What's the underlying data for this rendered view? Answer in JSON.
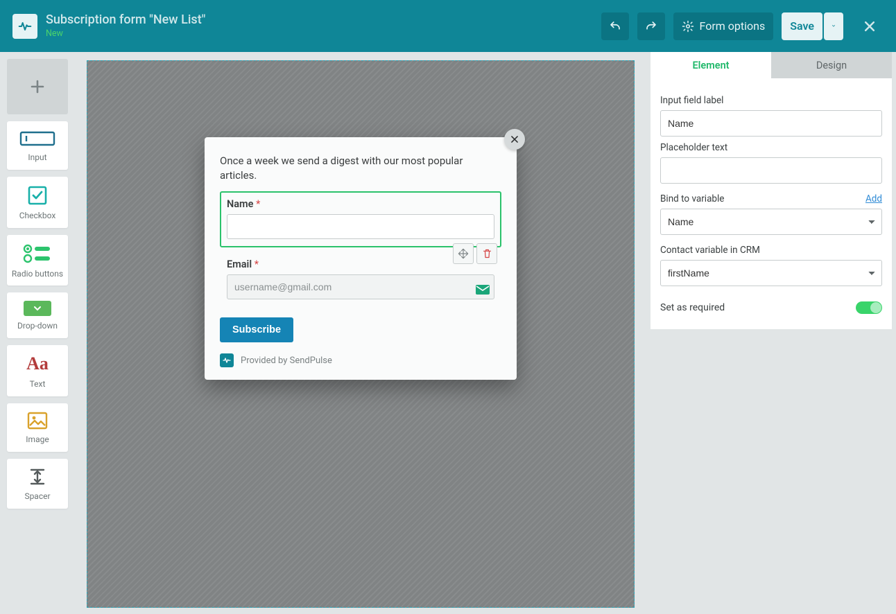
{
  "topbar": {
    "title": "Subscription form \"New List\"",
    "subtitle": "New",
    "form_options": "Form options",
    "save": "Save"
  },
  "tools": {
    "input": "Input",
    "checkbox": "Checkbox",
    "radio": "Radio buttons",
    "dropdown": "Drop-down",
    "text": "Text",
    "image": "Image",
    "spacer": "Spacer"
  },
  "form": {
    "description": "Once a week we send a digest with our most popular articles.",
    "name_label": "Name",
    "email_label": "Email",
    "email_placeholder": "username@gmail.com",
    "subscribe": "Subscribe",
    "provided": "Provided by SendPulse"
  },
  "panel": {
    "tab_element": "Element",
    "tab_design": "Design",
    "label_field_label": "Input field label",
    "field_label_value": "Name",
    "label_placeholder": "Placeholder text",
    "placeholder_value": "",
    "label_bind": "Bind to variable",
    "add_link": "Add",
    "bind_value": "Name",
    "label_crm": "Contact variable in CRM",
    "crm_value": "firstName",
    "required": "Set as required"
  }
}
